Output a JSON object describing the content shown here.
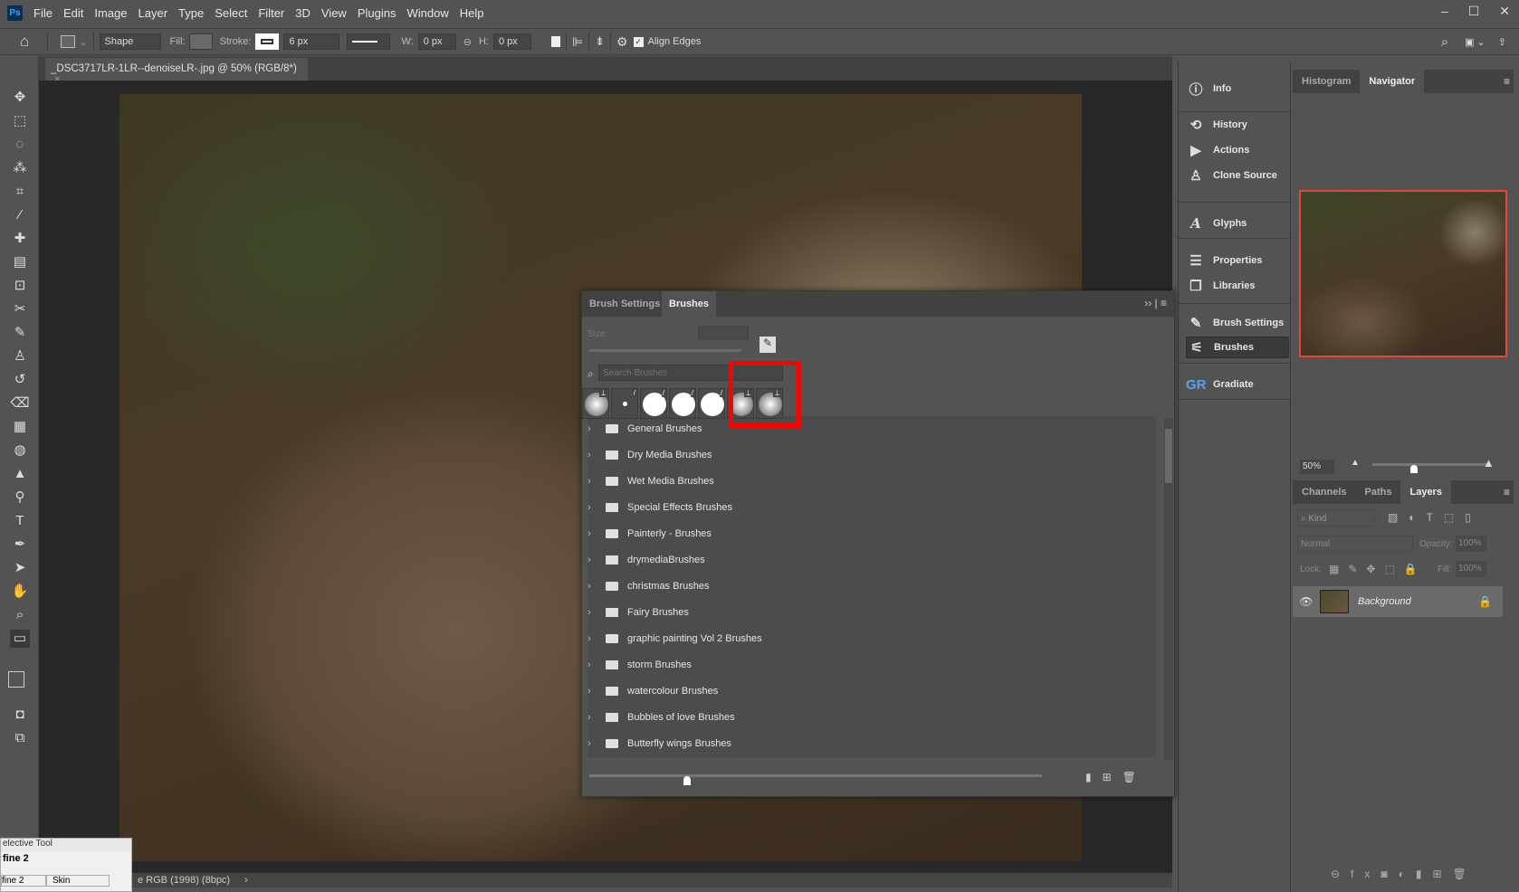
{
  "app": {
    "logo": "Ps",
    "menu": [
      "File",
      "Edit",
      "Image",
      "Layer",
      "Type",
      "Select",
      "Filter",
      "3D",
      "View",
      "Plugins",
      "Window",
      "Help"
    ],
    "window_controls": [
      "–",
      "☐",
      "✕"
    ]
  },
  "options": {
    "mode": "Shape",
    "fill_label": "Fill:",
    "stroke_label": "Stroke:",
    "stroke_width": "6 px",
    "w_label": "W:",
    "w_value": "0 px",
    "h_label": "H:",
    "h_value": "0 px",
    "align_edges": "Align Edges",
    "align_edges_checked": true
  },
  "document": {
    "tab_title": "_DSC3717LR-1LR--denoiseLR-.jpg @ 50% (RGB/8*)",
    "status": "e RGB (1998) (8bpc)"
  },
  "selective_tool": {
    "title": "elective Tool",
    "heading": "fine 2",
    "cells": [
      "fine 2",
      "Skin"
    ]
  },
  "dock": {
    "items": [
      "Info",
      "History",
      "Actions",
      "Clone Source",
      "Glyphs",
      "Properties",
      "Libraries",
      "Brush Settings",
      "Brushes",
      "Gradiate"
    ],
    "active": "Brushes"
  },
  "navigator": {
    "tabs": [
      "Histogram",
      "Navigator"
    ],
    "active": "Navigator",
    "zoom": "50%",
    "highlight_color": "#e8453c"
  },
  "layers": {
    "tabs": [
      "Channels",
      "Paths",
      "Layers"
    ],
    "active": "Layers",
    "filter": "Kind",
    "blend_mode": "Normal",
    "opacity_label": "Opacity:",
    "opacity": "100%",
    "lock_label": "Lock:",
    "fill_label": "Fill:",
    "fill": "100%",
    "items": [
      {
        "name": "Background",
        "visible": true,
        "locked": true
      }
    ]
  },
  "brushes_panel": {
    "tabs": [
      "Brush Settings",
      "Brushes"
    ],
    "active": "Brushes",
    "size_label": "Size:",
    "search_placeholder": "Search Brushes",
    "highlight_color": "#ff0000",
    "groups": [
      "General Brushes",
      "Dry Media Brushes",
      "Wet Media Brushes",
      "Special Effects Brushes",
      "Painterly - Brushes",
      "drymediaBrushes",
      "christmas Brushes",
      "Fairy Brushes",
      "graphic painting Vol 2  Brushes",
      "storm Brushes",
      "watercolour Brushes",
      "Bubbles of love Brushes",
      "Butterfly wings Brushes"
    ]
  }
}
